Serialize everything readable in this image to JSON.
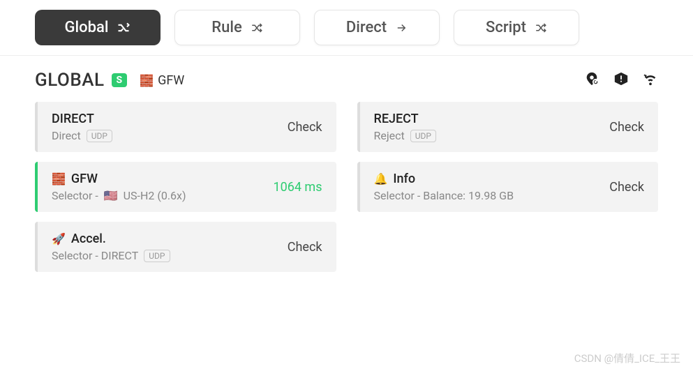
{
  "tabs": [
    {
      "label": "Global",
      "active": true
    },
    {
      "label": "Rule",
      "active": false
    },
    {
      "label": "Direct",
      "active": false
    },
    {
      "label": "Script",
      "active": false
    }
  ],
  "header": {
    "title": "GLOBAL",
    "badge": "S",
    "gfw_icon": "🧱",
    "gfw_label": "GFW"
  },
  "cards": {
    "direct": {
      "title": "DIRECT",
      "sub": "Direct",
      "udp": "UDP",
      "action": "Check"
    },
    "reject": {
      "title": "REJECT",
      "sub": "Reject",
      "udp": "UDP",
      "action": "Check"
    },
    "gfw": {
      "icon": "🧱",
      "title": "GFW",
      "sub_prefix": "Selector - ",
      "flag": "🇺🇸",
      "sub_proxy": "US-H2 (0.6x)",
      "action": "1064 ms"
    },
    "info": {
      "icon": "🔔",
      "title": "Info",
      "sub": "Selector - Balance: 19.98 GB",
      "action": "Check"
    },
    "accel": {
      "icon": "🚀",
      "title": "Accel.",
      "sub": "Selector - DIRECT",
      "udp": "UDP",
      "action": "Check"
    }
  },
  "watermark": "CSDN @倩倩_ICE_王王"
}
